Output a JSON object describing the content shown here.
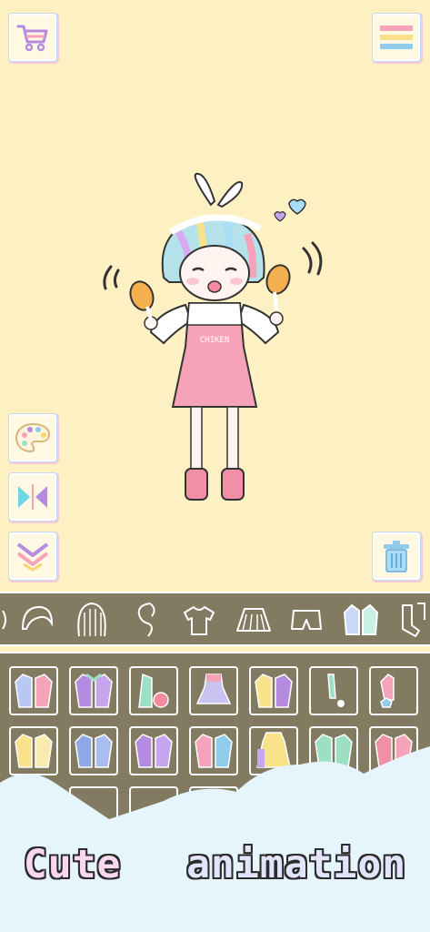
{
  "caption": {
    "word1": "Cute",
    "word2": "animation"
  },
  "shirt_text": "CHIKEN",
  "colors": {
    "background": "#fdf0c2",
    "panel": "#827a61",
    "cloud": "#e6f4fb",
    "dress_pink": "#f6a3b9"
  },
  "top_buttons": [
    {
      "id": "shop",
      "icon": "shopping-cart-icon"
    },
    {
      "id": "menu",
      "icon": "menu-lines-icon"
    }
  ],
  "side_buttons": [
    {
      "id": "palette",
      "icon": "palette-icon"
    },
    {
      "id": "flip",
      "icon": "flip-icon"
    },
    {
      "id": "collapse",
      "icon": "double-chevron-down-icon"
    },
    {
      "id": "trash",
      "icon": "trash-icon"
    }
  ],
  "categories": [
    {
      "icon": "hair-short-icon"
    },
    {
      "icon": "hair-long-icon"
    },
    {
      "icon": "hair-side-icon"
    },
    {
      "icon": "tshirt-icon"
    },
    {
      "icon": "skirt-icon"
    },
    {
      "icon": "shorts-icon"
    },
    {
      "icon": "jacket-icon",
      "selected": true
    },
    {
      "icon": "socks-icon"
    }
  ],
  "items": [
    {
      "icon": "jacket-item-icon"
    },
    {
      "icon": "jacket-item-icon"
    },
    {
      "icon": "jacket-item-icon"
    },
    {
      "icon": "dress-item-icon"
    },
    {
      "icon": "jacket-item-icon"
    },
    {
      "icon": "scarf-item-icon"
    },
    {
      "icon": "jacket-item-icon"
    },
    {
      "icon": "jacket-item-icon"
    },
    {
      "icon": "jacket-item-icon"
    },
    {
      "icon": "jacket-item-icon"
    },
    {
      "icon": "jacket-item-icon"
    },
    {
      "icon": "hoodie-item-icon"
    },
    {
      "icon": "jacket-item-icon"
    },
    {
      "icon": "jacket-item-icon"
    }
  ]
}
